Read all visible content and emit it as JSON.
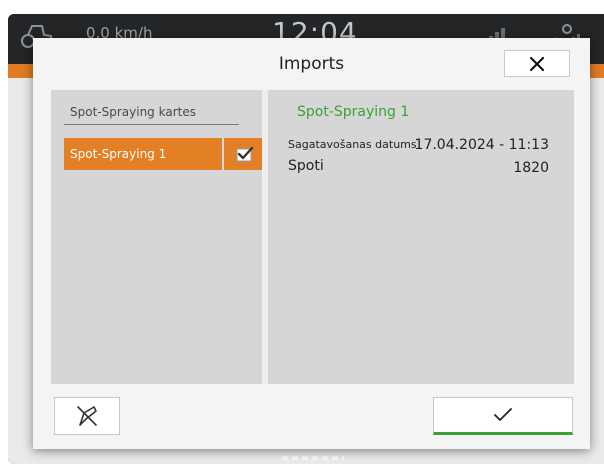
{
  "status_bar": {
    "speed": "0.0 km/h",
    "clock": "12:04",
    "icons": [
      "tractor-icon",
      "signal-icon",
      "gps-icon"
    ]
  },
  "dialog": {
    "title": "Imports",
    "close_icon": "close-icon",
    "list": {
      "heading": "Spot-Spraying kartes",
      "items": [
        {
          "label": "Spot-Spraying 1",
          "selected": true,
          "check_icon": "checkbox-checked-icon"
        }
      ]
    },
    "details": {
      "title": "Spot-Spraying 1",
      "created_label": "Sagatavošanas datums",
      "created_value": "17.04.2024 - 11:13",
      "spots_label": "Spoti",
      "spots_value": "1820"
    },
    "footer": {
      "left_button_icon": "spray-off-icon",
      "confirm_icon": "checkmark-icon"
    }
  },
  "colors": {
    "accent_orange": "#e37f25",
    "accent_green": "#3aa13a",
    "panel_gray": "#d6d6d6"
  }
}
